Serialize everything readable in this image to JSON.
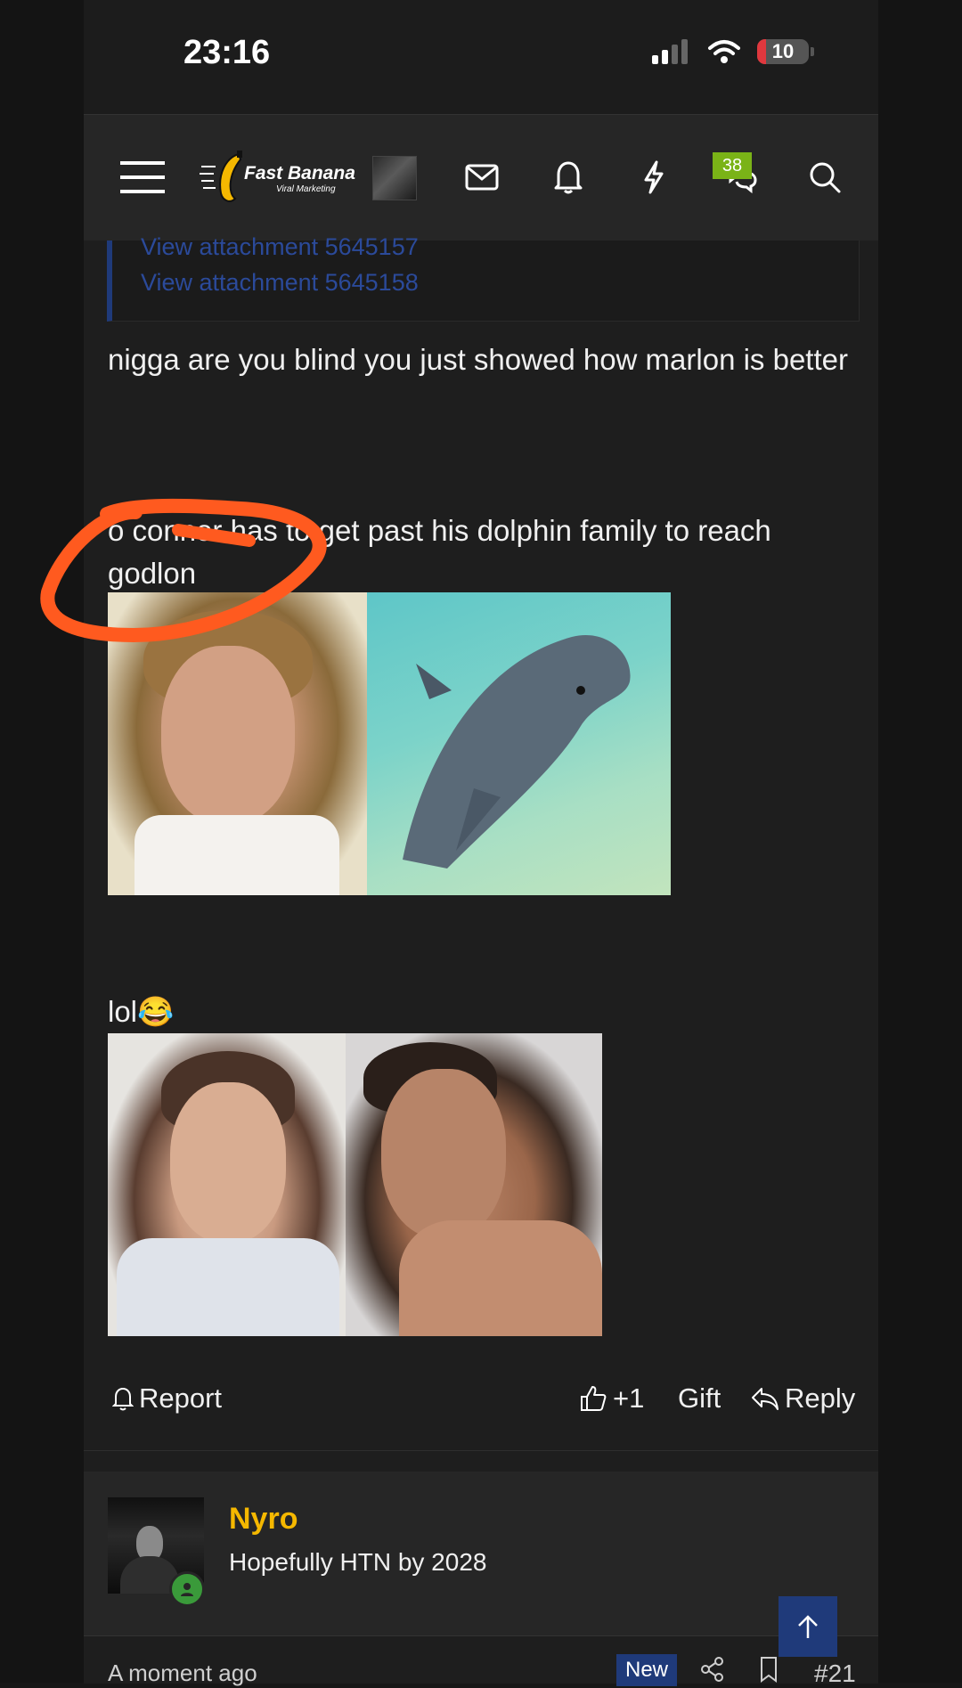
{
  "status_bar": {
    "time": "23:16",
    "battery_level": "10"
  },
  "nav": {
    "logo_title": "Fast Banana",
    "logo_subtitle": "Viral Marketing",
    "conversations_badge": "38"
  },
  "quote": {
    "attachments": [
      "View attachment 5645157",
      "View attachment 5645158"
    ]
  },
  "post": {
    "paragraph_1": "nigga are you blind you just showed how marlon is better",
    "paragraph_2": "o connor has to get past his dolphin family to reach godlon",
    "paragraph_3": "lol😂"
  },
  "actions": {
    "report": "Report",
    "like": "+1",
    "gift": "Gift",
    "reply": "Reply"
  },
  "next_post": {
    "username": "Nyro",
    "user_title": "Hopefully HTN by 2028",
    "timestamp": "A moment ago",
    "new_label": "New",
    "post_number": "#21"
  },
  "colors": {
    "accent_blue": "#1f3a7a",
    "username_gold": "#f5b800",
    "badge_green": "#7ab317",
    "annotation_orange": "#ff5a1f"
  }
}
